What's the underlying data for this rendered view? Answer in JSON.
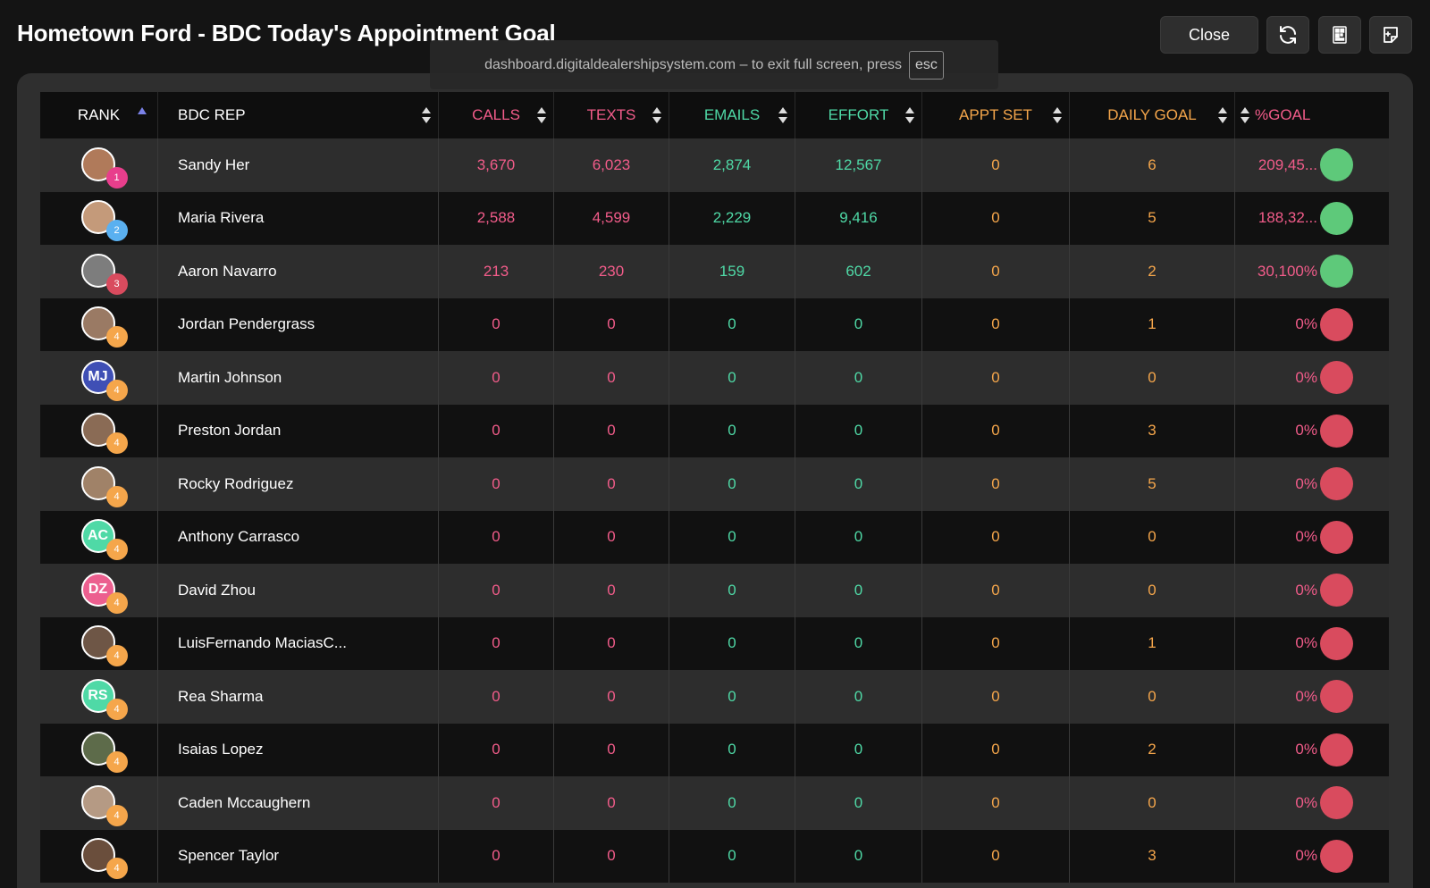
{
  "header": {
    "title": "Hometown Ford - BDC Today's Appointment Goal",
    "close_label": "Close",
    "refresh_icon": "refresh-icon",
    "qr_icon": "qr-code-icon",
    "note_icon": "note-add-icon"
  },
  "fullscreen_notice": {
    "text": "dashboard.digitaldealershipsystem.com – to exit full screen, press",
    "key": "esc"
  },
  "colors": {
    "pink": "#f25c8a",
    "teal": "#4fd9a6",
    "orange": "#f5a64b",
    "green": "#5ec97a",
    "red": "#d94b5e"
  },
  "columns": {
    "rank": "RANK",
    "rep": "BDC REP",
    "calls": "CALLS",
    "texts": "TEXTS",
    "emails": "EMAILS",
    "effort": "EFFORT",
    "appt": "APPT SET",
    "goal": "DAILY GOAL",
    "pct": "%GOAL"
  },
  "rows": [
    {
      "rank": "1",
      "name": "Sandy Her",
      "initials": "",
      "avatar_color": "#b07a5a",
      "badge_color": "#e83e8c",
      "calls": "3,670",
      "texts": "6,023",
      "emails": "2,874",
      "effort": "12,567",
      "appt": "0",
      "goal": "6",
      "pct": "209,45...",
      "status": "green"
    },
    {
      "rank": "2",
      "name": "Maria Rivera",
      "initials": "",
      "avatar_color": "#c49a7a",
      "badge_color": "#5ab0f0",
      "calls": "2,588",
      "texts": "4,599",
      "emails": "2,229",
      "effort": "9,416",
      "appt": "0",
      "goal": "5",
      "pct": "188,32...",
      "status": "green"
    },
    {
      "rank": "3",
      "name": "Aaron Navarro",
      "initials": "",
      "avatar_color": "#7d7d7d",
      "badge_color": "#d94b5e",
      "calls": "213",
      "texts": "230",
      "emails": "159",
      "effort": "602",
      "appt": "0",
      "goal": "2",
      "pct": "30,100%",
      "status": "green"
    },
    {
      "rank": "4",
      "name": "Jordan Pendergrass",
      "initials": "",
      "avatar_color": "#9a7a64",
      "badge_color": "#f5a64b",
      "calls": "0",
      "texts": "0",
      "emails": "0",
      "effort": "0",
      "appt": "0",
      "goal": "1",
      "pct": "0%",
      "status": "red"
    },
    {
      "rank": "4",
      "name": "Martin Johnson",
      "initials": "MJ",
      "avatar_color": "#3f4fb5",
      "badge_color": "#f5a64b",
      "calls": "0",
      "texts": "0",
      "emails": "0",
      "effort": "0",
      "appt": "0",
      "goal": "0",
      "pct": "0%",
      "status": "red"
    },
    {
      "rank": "4",
      "name": "Preston Jordan",
      "initials": "",
      "avatar_color": "#8a6b55",
      "badge_color": "#f5a64b",
      "calls": "0",
      "texts": "0",
      "emails": "0",
      "effort": "0",
      "appt": "0",
      "goal": "3",
      "pct": "0%",
      "status": "red"
    },
    {
      "rank": "4",
      "name": "Rocky Rodriguez",
      "initials": "",
      "avatar_color": "#a08268",
      "badge_color": "#f5a64b",
      "calls": "0",
      "texts": "0",
      "emails": "0",
      "effort": "0",
      "appt": "0",
      "goal": "5",
      "pct": "0%",
      "status": "red"
    },
    {
      "rank": "4",
      "name": "Anthony Carrasco",
      "initials": "AC",
      "avatar_color": "#4fd9a6",
      "badge_color": "#f5a64b",
      "calls": "0",
      "texts": "0",
      "emails": "0",
      "effort": "0",
      "appt": "0",
      "goal": "0",
      "pct": "0%",
      "status": "red"
    },
    {
      "rank": "4",
      "name": "David Zhou",
      "initials": "DZ",
      "avatar_color": "#ec5f8f",
      "badge_color": "#f5a64b",
      "calls": "0",
      "texts": "0",
      "emails": "0",
      "effort": "0",
      "appt": "0",
      "goal": "0",
      "pct": "0%",
      "status": "red"
    },
    {
      "rank": "4",
      "name": "LuisFernando MaciasC...",
      "initials": "",
      "avatar_color": "#6e5646",
      "badge_color": "#f5a64b",
      "calls": "0",
      "texts": "0",
      "emails": "0",
      "effort": "0",
      "appt": "0",
      "goal": "1",
      "pct": "0%",
      "status": "red"
    },
    {
      "rank": "4",
      "name": "Rea Sharma",
      "initials": "RS",
      "avatar_color": "#4fd9a6",
      "badge_color": "#f5a64b",
      "calls": "0",
      "texts": "0",
      "emails": "0",
      "effort": "0",
      "appt": "0",
      "goal": "0",
      "pct": "0%",
      "status": "red"
    },
    {
      "rank": "4",
      "name": "Isaias Lopez",
      "initials": "",
      "avatar_color": "#5d6b4a",
      "badge_color": "#f5a64b",
      "calls": "0",
      "texts": "0",
      "emails": "0",
      "effort": "0",
      "appt": "0",
      "goal": "2",
      "pct": "0%",
      "status": "red"
    },
    {
      "rank": "4",
      "name": "Caden Mccaughern",
      "initials": "",
      "avatar_color": "#b59a84",
      "badge_color": "#f5a64b",
      "calls": "0",
      "texts": "0",
      "emails": "0",
      "effort": "0",
      "appt": "0",
      "goal": "0",
      "pct": "0%",
      "status": "red"
    },
    {
      "rank": "4",
      "name": "Spencer Taylor",
      "initials": "",
      "avatar_color": "#6a4e3c",
      "badge_color": "#f5a64b",
      "calls": "0",
      "texts": "0",
      "emails": "0",
      "effort": "0",
      "appt": "0",
      "goal": "3",
      "pct": "0%",
      "status": "red"
    }
  ]
}
